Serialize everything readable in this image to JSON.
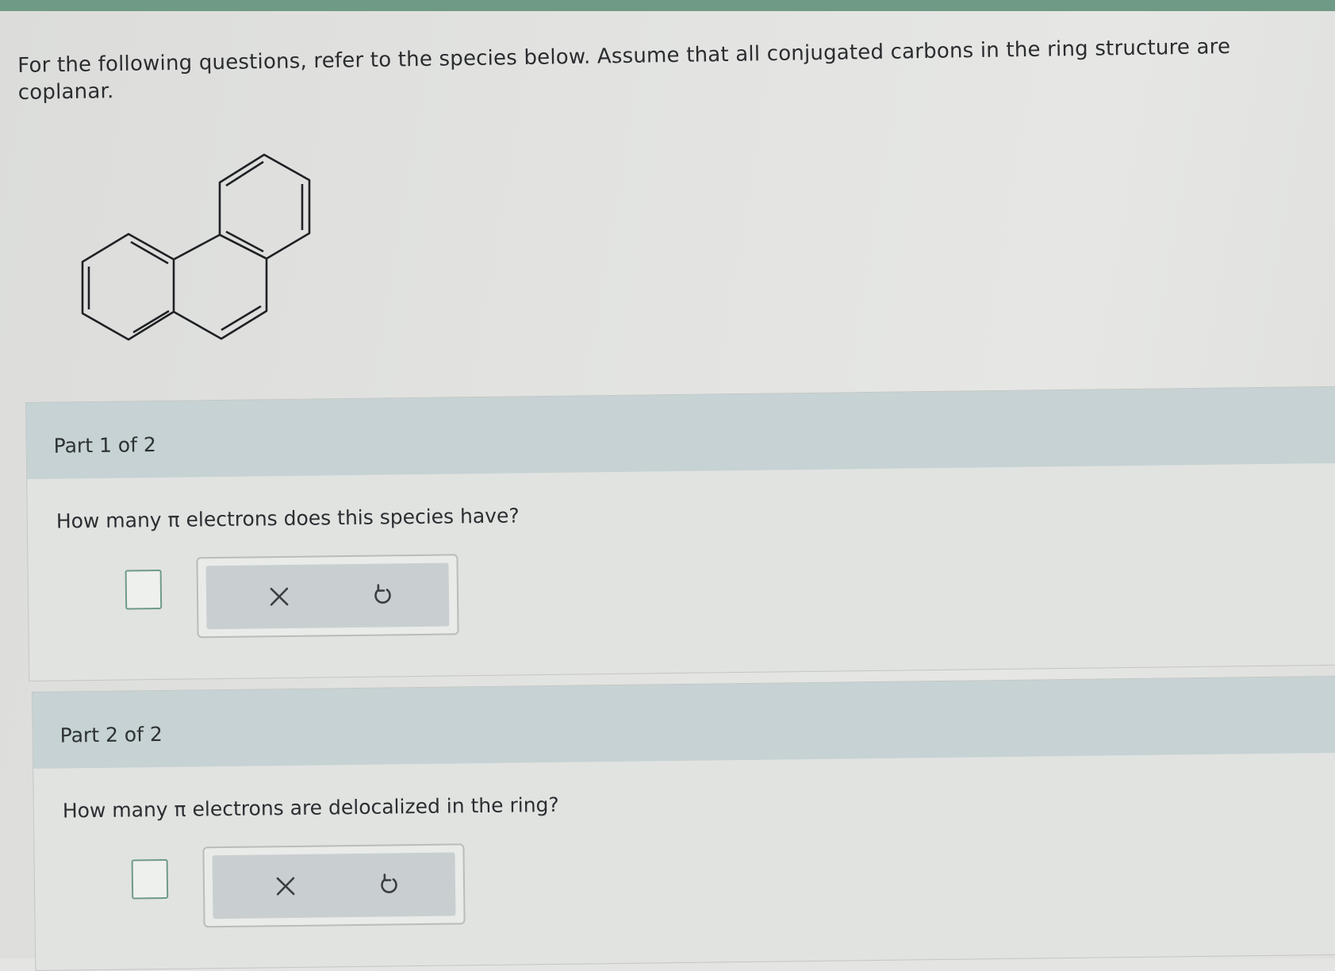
{
  "intro_text": "For the following questions, refer to the species below. Assume that all conjugated carbons in the ring structure are coplanar.",
  "molecule": {
    "icon": "phenanthrene-structure"
  },
  "parts": [
    {
      "label": "Part 1 of 2",
      "question": "How many π electrons does this species have?",
      "answer_value": "",
      "tools": {
        "clear_icon": "x-icon",
        "undo_icon": "undo-icon"
      }
    },
    {
      "label": "Part 2 of 2",
      "question": "How many π electrons are delocalized in the ring?",
      "answer_value": "",
      "tools": {
        "clear_icon": "x-icon",
        "undo_icon": "undo-icon"
      }
    }
  ],
  "colors": {
    "accent": "#6f9b88",
    "header_bg": "#c6d2d3",
    "top_strip": "#6f9a85"
  }
}
